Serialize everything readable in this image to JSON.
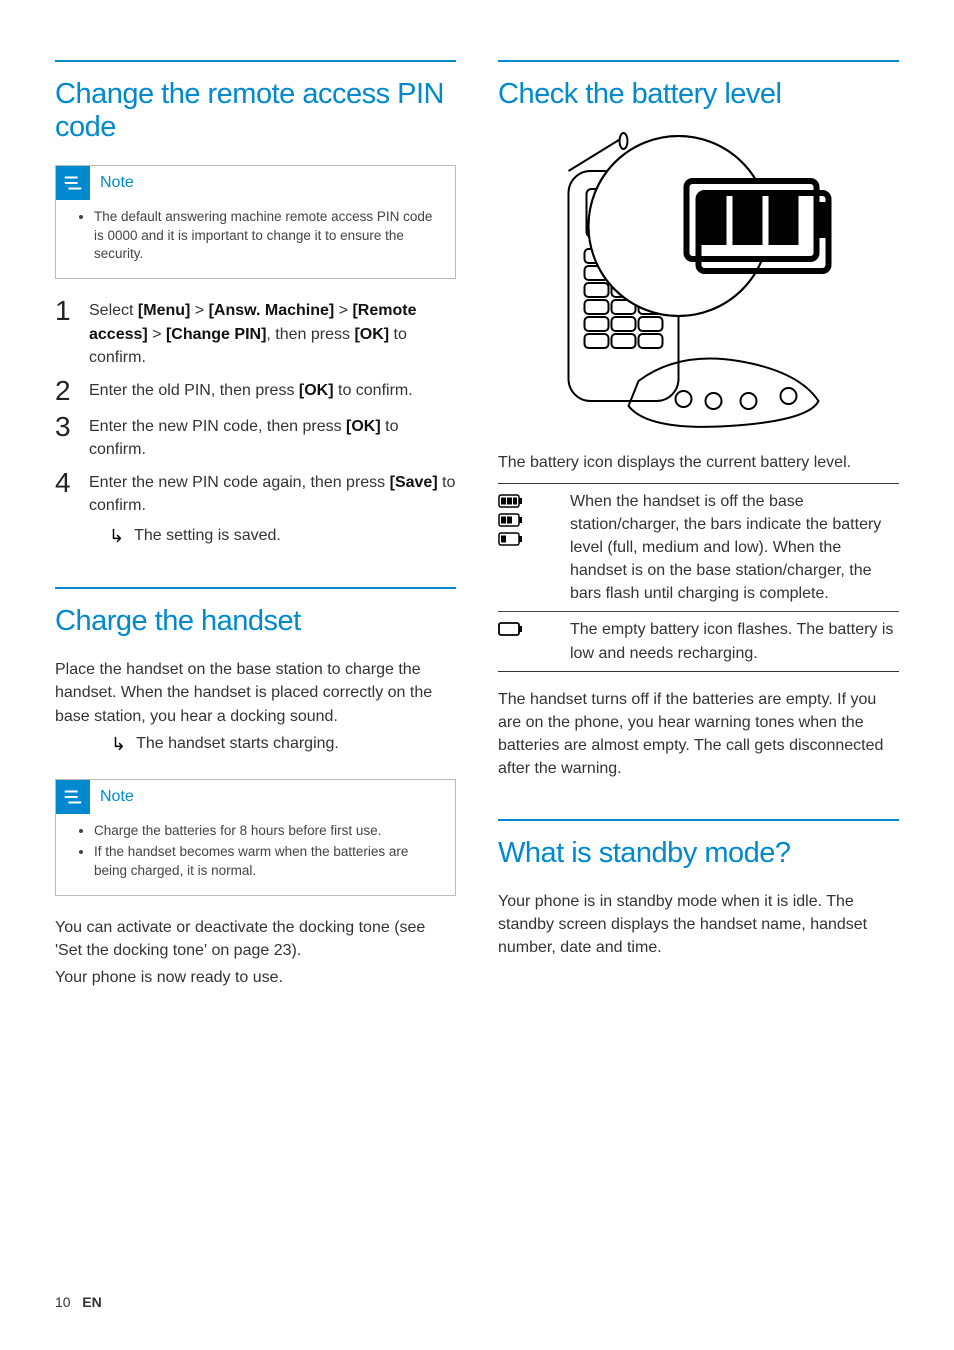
{
  "col1": {
    "s1": {
      "heading": "Change the remote access PIN code",
      "note_label": "Note",
      "note_items": [
        "The default answering machine remote access PIN code is 0000 and it is important to change it to ensure the security."
      ],
      "steps": [
        {
          "pre": "Select ",
          "b1": "[Menu]",
          "m1": " > ",
          "b2": "[Answ. Machine]",
          "m2": " > ",
          "b3": "[Remote access]",
          "m3": " > ",
          "b4": "[Change PIN]",
          "m4": ", then press ",
          "b5": "[OK]",
          "suf": " to confirm."
        },
        {
          "pre": "Enter the old PIN, then press ",
          "b1": "[OK]",
          "suf": " to confirm."
        },
        {
          "pre": "Enter the new PIN code, then press ",
          "b1": "[OK]",
          "suf": " to confirm."
        },
        {
          "pre": "Enter the new PIN code again, then press ",
          "b1": "[Save]",
          "suf": " to confirm.",
          "result": "The setting is saved."
        }
      ]
    },
    "s2": {
      "heading": "Charge the handset",
      "intro": "Place the handset on the base station to charge the handset. When the handset is placed correctly on the base station, you hear a docking sound.",
      "result": "The handset starts charging.",
      "note_label": "Note",
      "note_items": [
        "Charge the batteries for 8 hours before first use.",
        "If the handset becomes warm when the batteries are being charged, it is normal."
      ],
      "after1": "You can activate or deactivate the docking tone (see 'Set the docking tone' on page 23).",
      "after2": "Your phone is now ready to use."
    }
  },
  "col2": {
    "s3": {
      "heading": "Check the battery level",
      "caption": "The battery icon displays the current battery level.",
      "row1": "When the handset is off the base station/charger, the bars indicate the battery level (full, medium and low). When the handset is on the base station/charger, the bars flash until charging is complete.",
      "row2": "The empty battery icon flashes. The battery is low and needs recharging.",
      "after": "The handset turns off if the batteries are empty. If you are on the phone, you hear warning tones when the batteries are almost empty. The call gets disconnected after the warning."
    },
    "s4": {
      "heading": "What is standby mode?",
      "body": "Your phone is in standby mode when it is idle. The standby screen displays the handset name, handset number, date and time."
    }
  },
  "footer": {
    "page": "10",
    "lang": "EN"
  }
}
